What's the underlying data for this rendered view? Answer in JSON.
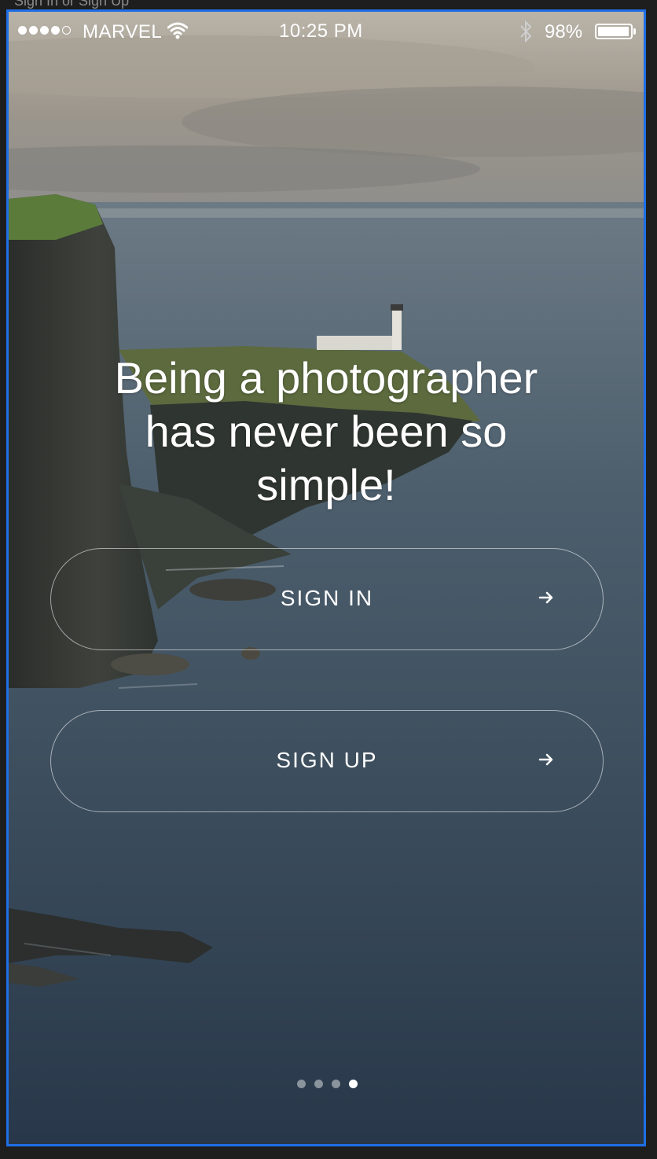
{
  "window": {
    "title": "Sign In or Sign Up"
  },
  "status_bar": {
    "carrier": "MARVEL",
    "time": "10:25 PM",
    "battery": "98%",
    "battery_level": 0.98,
    "signal_bars_filled": 4,
    "signal_bars_total": 5,
    "icons": [
      "wifi-icon",
      "bluetooth-icon",
      "battery-icon"
    ]
  },
  "hero": {
    "headline_lines": [
      "Being a photographer",
      "has never been so",
      "simple!"
    ]
  },
  "buttons": {
    "sign_in": {
      "label": "SIGN IN",
      "icon": "arrow-right-icon"
    },
    "sign_up": {
      "label": "SIGN UP",
      "icon": "arrow-right-icon"
    }
  },
  "pager": {
    "total": 4,
    "active_index": 3
  },
  "colors": {
    "frame_border": "#1f6fe6",
    "text": "#ffffff"
  }
}
